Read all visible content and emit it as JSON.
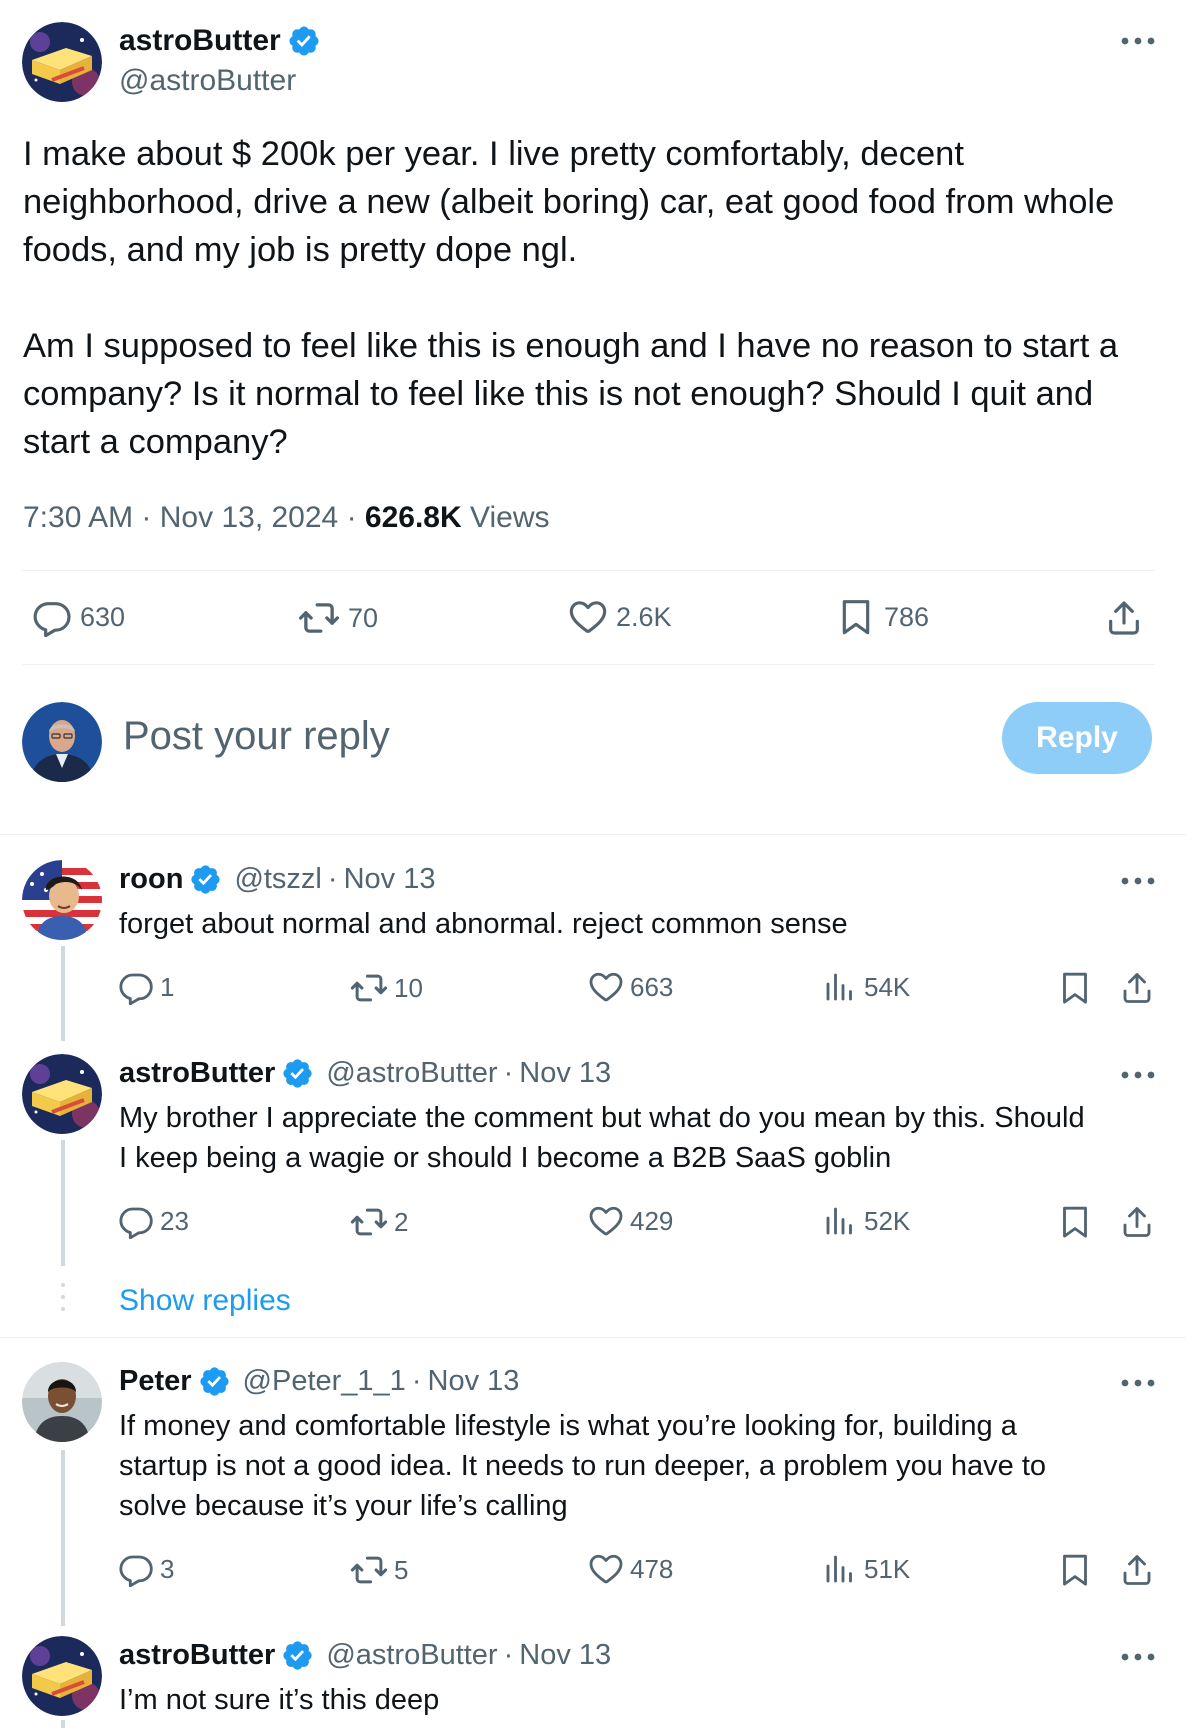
{
  "post": {
    "author_name": "astroButter",
    "author_handle": "@astroButter",
    "text_p1": "I make about $ 200k per year. I live pretty comfortably, decent neighborhood, drive a new (albeit boring) car, eat good food from whole foods, and my job is pretty dope ngl.",
    "text_p2": "Am I supposed to feel like this is enough and I have no reason to start a company? Is it normal to feel like this is not enough? Should I quit and start a company?",
    "time": "7:30 AM",
    "date": "Nov 13, 2024",
    "views_count": "626.8K",
    "views_label": "Views",
    "replies": "630",
    "reposts": "70",
    "likes": "2.6K",
    "bookmarks": "786"
  },
  "composer": {
    "placeholder": "Post your reply",
    "reply_button": "Reply"
  },
  "replies": [
    {
      "name": "roon",
      "handle": "@tszzl",
      "date": "Nov 13",
      "text": "forget about normal and abnormal. reject common sense",
      "replies": "1",
      "reposts": "10",
      "likes": "663",
      "views": "54K"
    },
    {
      "name": "astroButter",
      "handle": "@astroButter",
      "date": "Nov 13",
      "text_l1": "My brother I appreciate the comment but what do you mean by this. Should",
      "text_l2": "I keep being a wagie or should I become a B2B SaaS goblin",
      "replies": "23",
      "reposts": "2",
      "likes": "429",
      "views": "52K"
    },
    {
      "name": "Peter",
      "handle": "@Peter_1_1",
      "date": "Nov 13",
      "text_l1": "If money and comfortable lifestyle is what you’re looking for, building a",
      "text_l2": "startup is not a good idea. It needs to run deeper, a problem you have to",
      "text_l3": "solve because it’s your life’s calling",
      "replies": "3",
      "reposts": "5",
      "likes": "478",
      "views": "51K"
    },
    {
      "name": "astroButter",
      "handle": "@astroButter",
      "date": "Nov 13",
      "text": "I’m not sure it’s this deep"
    }
  ],
  "show_replies": "Show replies",
  "separator": "·",
  "colors": {
    "accent": "#1d9bf0",
    "reply_button_disabled": "#8ecdf7",
    "text_primary": "#0f1419",
    "text_secondary": "#536471"
  }
}
